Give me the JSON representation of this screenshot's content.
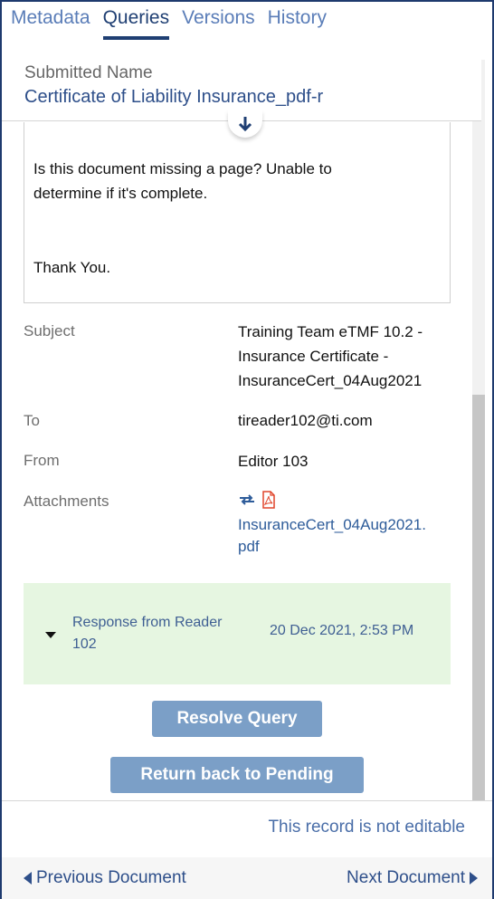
{
  "tabs": [
    {
      "label": "Metadata",
      "active": false
    },
    {
      "label": "Queries",
      "active": true
    },
    {
      "label": "Versions",
      "active": false
    },
    {
      "label": "History",
      "active": false
    }
  ],
  "header": {
    "submitted_label": "Submitted Name",
    "submitted_value": "Certificate of Liability Insurance_pdf-r",
    "scroll_icon": "arrow-down-icon"
  },
  "message": {
    "line1": "Is this document missing a page? Unable to",
    "line2": "determine if it's complete.",
    "closing": "Thank You."
  },
  "details": {
    "subject_label": "Subject",
    "subject_lines": [
      "Training Team eTMF 10.2 -",
      "Insurance Certificate -",
      "InsuranceCert_04Aug2021"
    ],
    "to_label": "To",
    "to_value": "tireader102@ti.com",
    "from_label": "From",
    "from_value": "Editor 103",
    "attachments_label": "Attachments",
    "attachment_lines": [
      "InsuranceCert_04Aug2021.",
      "pdf"
    ],
    "attachment_icons": [
      "swap-icon",
      "pdf-icon"
    ]
  },
  "response": {
    "title_lines": [
      "Response from Reader",
      "102"
    ],
    "date": "20 Dec 2021, 2:53 PM",
    "bg_color": "#e6f6e1"
  },
  "buttons": {
    "resolve": "Resolve Query",
    "return": "Return back to Pending",
    "color": "#7b9fc7"
  },
  "footer": {
    "not_editable": "This record is not editable",
    "prev": "Previous Document",
    "next": "Next Document"
  }
}
